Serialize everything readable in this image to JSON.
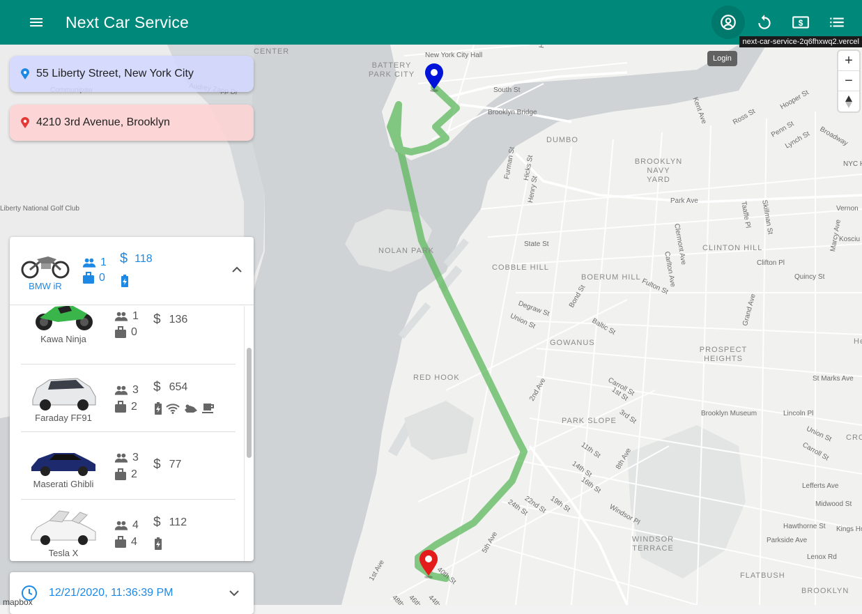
{
  "appbar": {
    "title": "Next Car Service",
    "url_tooltip": "next-car-service-2q6fhxwq2.vercel",
    "login_tooltip": "Login"
  },
  "route": {
    "origin": "55 Liberty Street, New York City",
    "destination": "4210 3rd Avenue, Brooklyn"
  },
  "selected_car": {
    "name": "BMW iR",
    "passengers": "1",
    "luggage": "0",
    "price": "118",
    "features": [
      "electric"
    ]
  },
  "cars": [
    {
      "name": "Kawa Ninja",
      "passengers": "1",
      "luggage": "0",
      "price": "136",
      "features": []
    },
    {
      "name": "Faraday FF91",
      "passengers": "3",
      "luggage": "2",
      "price": "654",
      "features": [
        "electric",
        "wifi",
        "massage",
        "coffee"
      ]
    },
    {
      "name": "Maserati Ghibli",
      "passengers": "3",
      "luggage": "2",
      "price": "77",
      "features": []
    },
    {
      "name": "Tesla X",
      "passengers": "4",
      "luggage": "4",
      "price": "112",
      "features": [
        "electric"
      ]
    }
  ],
  "pickup_time": "12/21/2020, 11:36:39 PM",
  "map": {
    "labels": [
      {
        "text": "New York City Hall",
        "kind": "place"
      },
      {
        "text": "BATTERY PARK CITY",
        "kind": "district"
      },
      {
        "text": "Henry St",
        "kind": "street"
      },
      {
        "text": "South St",
        "kind": "street"
      },
      {
        "text": "Brooklyn Bridge",
        "kind": "street"
      },
      {
        "text": "DUMBO",
        "kind": "district"
      },
      {
        "text": "BROOKLYN NAVY YARD",
        "kind": "district"
      },
      {
        "text": "Park Ave",
        "kind": "street"
      },
      {
        "text": "NOLAN PARK",
        "kind": "district"
      },
      {
        "text": "COBBLE HILL",
        "kind": "district"
      },
      {
        "text": "BOERUM HILL",
        "kind": "district"
      },
      {
        "text": "CLINTON HILL",
        "kind": "district"
      },
      {
        "text": "GOWANUS",
        "kind": "district"
      },
      {
        "text": "PROSPECT HEIGHTS",
        "kind": "district"
      },
      {
        "text": "RED HOOK",
        "kind": "district"
      },
      {
        "text": "PARK SLOPE",
        "kind": "district"
      },
      {
        "text": "Brooklyn Museum",
        "kind": "place"
      },
      {
        "text": "WINDSOR TERRACE",
        "kind": "district"
      },
      {
        "text": "FLATBUSH",
        "kind": "district"
      },
      {
        "text": "BROOKLYN",
        "kind": "district"
      },
      {
        "text": "Kings Hospital",
        "kind": "place"
      },
      {
        "text": "Liberty National Golf Club",
        "kind": "place"
      },
      {
        "text": "Communipaw",
        "kind": "place"
      },
      {
        "text": "Audrey Zapp Dr",
        "kind": "street"
      },
      {
        "text": "Fulton St",
        "kind": "street"
      },
      {
        "text": "Union St",
        "kind": "street"
      },
      {
        "text": "Degraw St",
        "kind": "street"
      },
      {
        "text": "State St",
        "kind": "street"
      },
      {
        "text": "2nd Ave",
        "kind": "street"
      },
      {
        "text": "5th Ave",
        "kind": "street"
      },
      {
        "text": "1st Ave",
        "kind": "street"
      },
      {
        "text": "40th St",
        "kind": "street"
      },
      {
        "text": "24th St",
        "kind": "street"
      },
      {
        "text": "22nd St",
        "kind": "street"
      },
      {
        "text": "19th St",
        "kind": "street"
      },
      {
        "text": "Windsor Pl",
        "kind": "street"
      },
      {
        "text": "Carroll St",
        "kind": "street"
      },
      {
        "text": "St Marks Ave",
        "kind": "street"
      },
      {
        "text": "Lincoln Pl",
        "kind": "street"
      },
      {
        "text": "Lefferts Ave",
        "kind": "street"
      },
      {
        "text": "Midwood St",
        "kind": "street"
      },
      {
        "text": "Hawthorne St",
        "kind": "street"
      },
      {
        "text": "Parkside Ave",
        "kind": "street"
      },
      {
        "text": "Lenox Rd",
        "kind": "street"
      },
      {
        "text": "Clifton Pl",
        "kind": "street"
      },
      {
        "text": "Quincy St",
        "kind": "street"
      },
      {
        "text": "Vernon",
        "kind": "street"
      },
      {
        "text": "Kosciu",
        "kind": "street"
      },
      {
        "text": "NYC Hospital",
        "kind": "place"
      },
      {
        "text": "Broadway",
        "kind": "street"
      },
      {
        "text": "Hooper St",
        "kind": "street"
      },
      {
        "text": "Penn St",
        "kind": "street"
      },
      {
        "text": "Lynch St",
        "kind": "street"
      },
      {
        "text": "Ross St",
        "kind": "street"
      },
      {
        "text": "Kent Ave",
        "kind": "street"
      },
      {
        "text": "Furman St",
        "kind": "street"
      },
      {
        "text": "Hicks St",
        "kind": "street"
      },
      {
        "text": "Henry St",
        "kind": "street"
      },
      {
        "text": "Clermont Ave",
        "kind": "street"
      },
      {
        "text": "Carlton Ave",
        "kind": "street"
      },
      {
        "text": "Taaffe Pl",
        "kind": "street"
      },
      {
        "text": "Skillman St",
        "kind": "street"
      },
      {
        "text": "Marcy Ave",
        "kind": "street"
      },
      {
        "text": "Grand Ave",
        "kind": "street"
      },
      {
        "text": "Baltic St",
        "kind": "street"
      },
      {
        "text": "Bond St",
        "kind": "street"
      },
      {
        "text": "1st St",
        "kind": "street"
      },
      {
        "text": "3rd St",
        "kind": "street"
      },
      {
        "text": "11th St",
        "kind": "street"
      },
      {
        "text": "14th St",
        "kind": "street"
      },
      {
        "text": "16th St",
        "kind": "street"
      },
      {
        "text": "8th Ave",
        "kind": "street"
      },
      {
        "text": "Union St",
        "kind": "street"
      },
      {
        "text": "Carroll St",
        "kind": "street"
      },
      {
        "text": "CENTER",
        "kind": "district"
      },
      {
        "text": "He",
        "kind": "district"
      },
      {
        "text": "CRO HE",
        "kind": "district"
      },
      {
        "text": "44th St",
        "kind": "street"
      },
      {
        "text": "46th St",
        "kind": "street"
      },
      {
        "text": "48th St",
        "kind": "street"
      }
    ]
  },
  "attribution": "mapbox",
  "colors": {
    "appbar": "#00897b",
    "route": "#5cb85c",
    "origin_pin": "#0014d9",
    "destination_pin": "#e31b1b",
    "accent": "#1e88e5"
  }
}
